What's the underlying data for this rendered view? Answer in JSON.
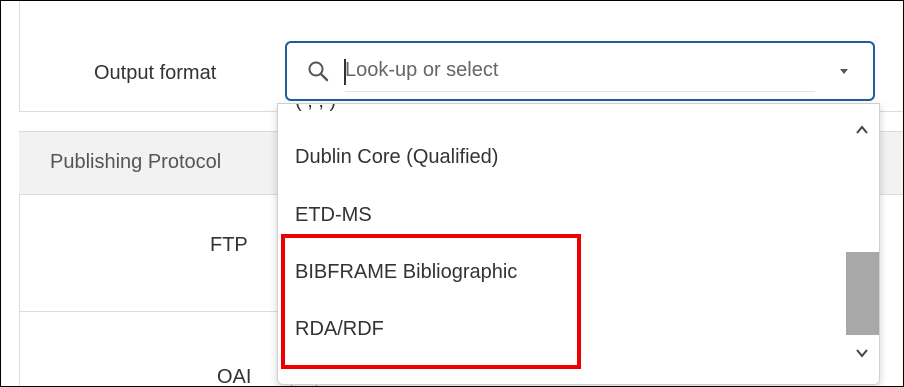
{
  "form": {
    "output_format_label": "Output format",
    "publishing_protocol_label": "Publishing Protocol",
    "ftp_label": "FTP",
    "oai_label": "OAI"
  },
  "select": {
    "placeholder": "Look-up or select",
    "value": "",
    "search_icon": "search-icon",
    "toggle_icon": "chevron-down-icon"
  },
  "dropdown": {
    "partially_hidden_item": "(  ,  ,  )",
    "options": [
      {
        "label": "Dublin Core (Qualified)",
        "highlighted": false
      },
      {
        "label": "ETD-MS",
        "highlighted": false
      },
      {
        "label": "BIBFRAME Bibliographic",
        "highlighted": true
      },
      {
        "label": "RDA/RDF",
        "highlighted": true
      }
    ],
    "scrollbar": {
      "up_icon": "chevron-up-icon",
      "down_icon": "chevron-down-icon",
      "scroll_position": 0.75
    }
  },
  "colors": {
    "focus_border": "#1f5d99",
    "highlight_border": "#ee0000",
    "header_background": "#f2f2f2",
    "scroll_thumb": "#a8a8a8"
  }
}
